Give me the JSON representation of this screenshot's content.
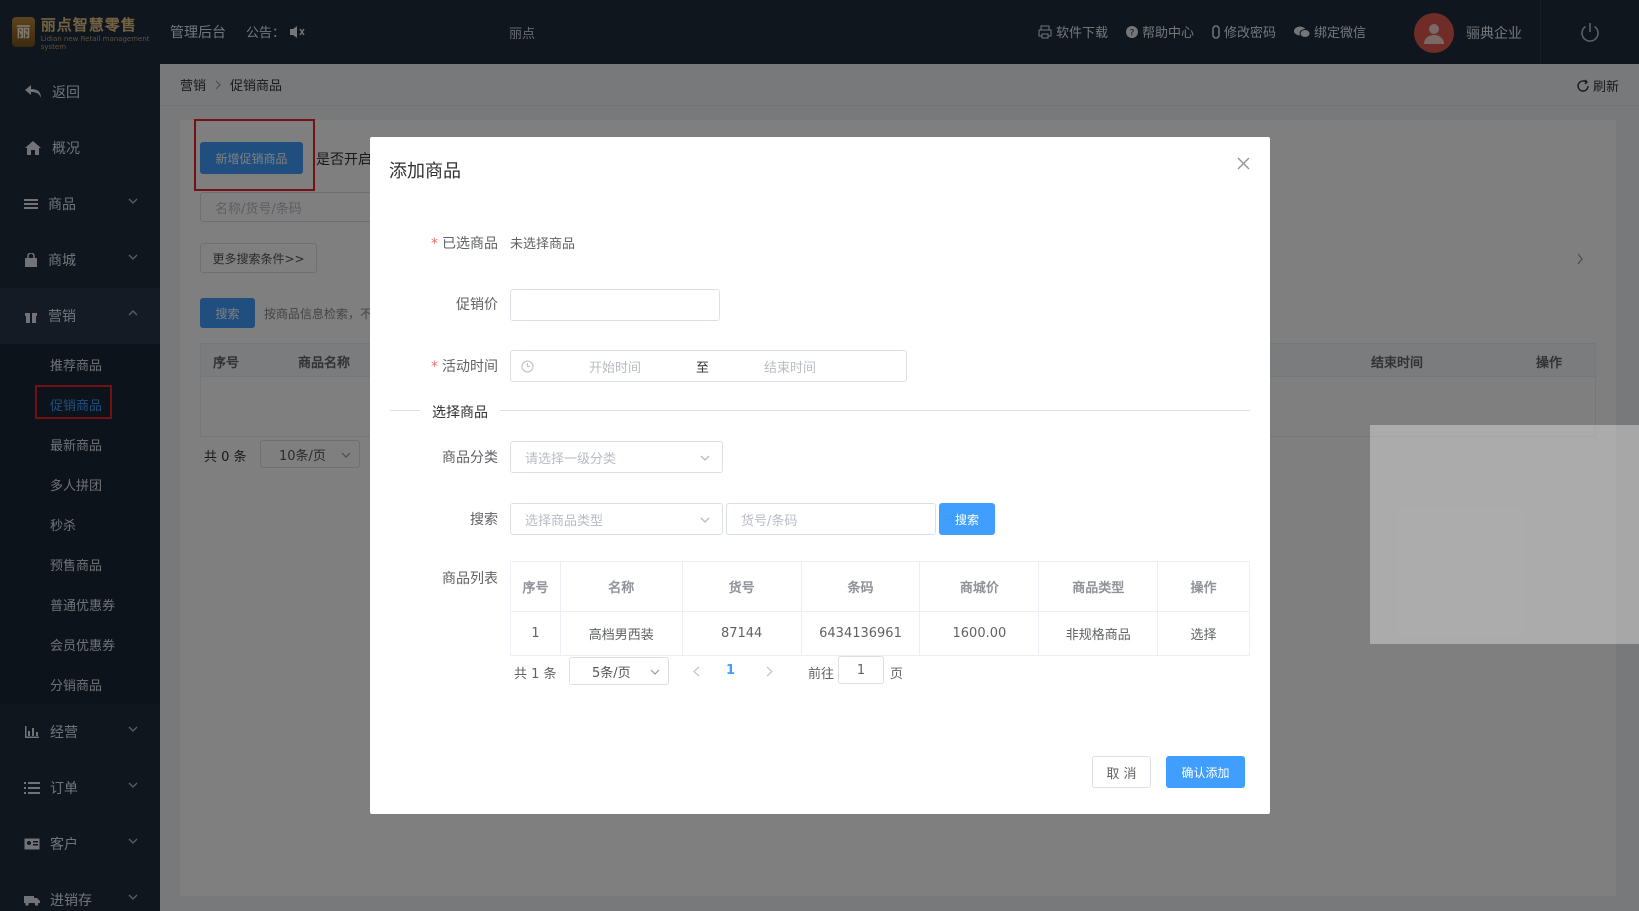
{
  "header": {
    "logo_title": "丽点智慧零售",
    "logo_sub": "Lidian new Retail management system",
    "admin": "管理后台",
    "notice_label": "公告：",
    "center_text": "丽点",
    "links": [
      "软件下载",
      "帮助中心",
      "修改密码",
      "绑定微信"
    ],
    "user_name": "骊典企业"
  },
  "sidebar": {
    "items": [
      {
        "label": "返回"
      },
      {
        "label": "概况"
      },
      {
        "label": "商品"
      },
      {
        "label": "商城"
      },
      {
        "label": "营销"
      }
    ],
    "sub_items": [
      "推荐商品",
      "促销商品",
      "最新商品",
      "多人拼团",
      "秒杀",
      "预售商品",
      "普通优惠券",
      "会员优惠券",
      "分销商品"
    ],
    "bottom_items": [
      {
        "label": "经营"
      },
      {
        "label": "订单"
      },
      {
        "label": "客户"
      },
      {
        "label": "进销存"
      }
    ]
  },
  "breadcrumb": {
    "root": "营销",
    "current": "促销商品",
    "refresh": "刷新"
  },
  "main": {
    "add_button": "新增促销商品",
    "open_label": "是否开启",
    "search_placeholder": "名称/货号/条码",
    "more_search": "更多搜索条件>>",
    "search_button": "搜索",
    "search_hint": "按商品信息检索，不",
    "table_headers": [
      "序号",
      "商品名称",
      "结束时间",
      "操作"
    ],
    "total": "共 0 条",
    "page_size": "10条/页"
  },
  "dialog": {
    "title": "添加商品",
    "selected_label": "已选商品",
    "selected_value": "未选择商品",
    "price_label": "促销价",
    "time_label": "活动时间",
    "start_placeholder": "开始时间",
    "to": "至",
    "end_placeholder": "结束时间",
    "section_title": "选择商品",
    "category_label": "商品分类",
    "category_placeholder": "请选择一级分类",
    "search_label": "搜索",
    "type_placeholder": "选择商品类型",
    "code_placeholder": "货号/条码",
    "search_button": "搜索",
    "list_label": "商品列表",
    "columns": [
      "序号",
      "名称",
      "货号",
      "条码",
      "商城价",
      "商品类型",
      "操作"
    ],
    "rows": [
      {
        "no": "1",
        "name": "高档男西装",
        "sku": "87144",
        "barcode": "6434136961",
        "price": "1600.00",
        "type": "非规格商品",
        "action": "选择"
      }
    ],
    "pagination": {
      "total": "共 1 条",
      "page_size": "5条/页",
      "current": "1",
      "goto": "前往",
      "goto_value": "1",
      "page_unit": "页"
    },
    "cancel": "取 消",
    "confirm": "确认添加"
  },
  "colors": {
    "primary": "#409eff",
    "dark": "#1f2d3d",
    "highlight": "#e5252a"
  }
}
